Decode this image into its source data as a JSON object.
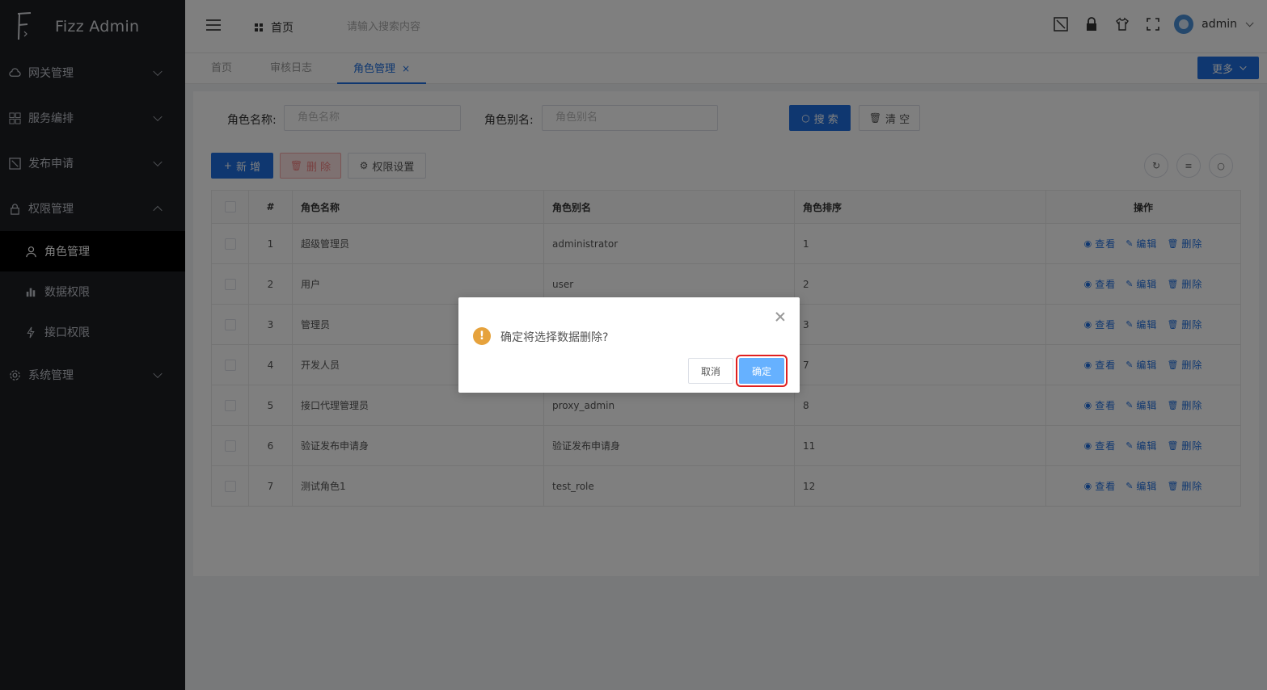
{
  "app": {
    "title": "Fizz Admin"
  },
  "sidebar": {
    "items": [
      {
        "label": "网关管理",
        "icon": "cloud-icon",
        "expanded": false
      },
      {
        "label": "服务编排",
        "icon": "grid-icon",
        "expanded": false
      },
      {
        "label": "发布申请",
        "icon": "publish-icon",
        "expanded": false
      },
      {
        "label": "权限管理",
        "icon": "lock-icon",
        "expanded": true,
        "children": [
          {
            "label": "角色管理",
            "icon": "user-icon",
            "active": true
          },
          {
            "label": "数据权限",
            "icon": "bar-chart-icon"
          },
          {
            "label": "接口权限",
            "icon": "lightning-icon"
          }
        ]
      },
      {
        "label": "系统管理",
        "icon": "gear-icon",
        "expanded": false
      }
    ]
  },
  "header": {
    "home_label": "首页",
    "search_placeholder": "请输入搜索内容",
    "username": "admin"
  },
  "tabs": {
    "items": [
      "首页",
      "审核日志",
      "角色管理"
    ],
    "close_label": "×",
    "more_label": "更多"
  },
  "filters": {
    "role_name_label": "角色名称:",
    "role_name_placeholder": "角色名称",
    "role_alias_label": "角色别名:",
    "role_alias_placeholder": "角色别名",
    "search_label": "搜 索",
    "clear_label": "清 空"
  },
  "toolbar": {
    "add_label": "新 增",
    "delete_label": "删 除",
    "perm_label": "权限设置"
  },
  "table": {
    "headers": [
      "#",
      "角色名称",
      "角色别名",
      "角色排序",
      "操作"
    ],
    "rows": [
      {
        "index": "1",
        "name": "超级管理员",
        "alias": "administrator",
        "sort": "1"
      },
      {
        "index": "2",
        "name": "用户",
        "alias": "user",
        "sort": "2"
      },
      {
        "index": "3",
        "name": "管理员",
        "alias": "",
        "sort": "3"
      },
      {
        "index": "4",
        "name": "开发人员",
        "alias": "",
        "sort": "7"
      },
      {
        "index": "5",
        "name": "接口代理管理员",
        "alias": "proxy_admin",
        "sort": "8"
      },
      {
        "index": "6",
        "name": "验证发布申请身",
        "alias": "验证发布申请身",
        "sort": "11"
      },
      {
        "index": "7",
        "name": "测试角色1",
        "alias": "test_role",
        "sort": "12"
      }
    ],
    "ops": {
      "view": "查看",
      "edit": "编辑",
      "delete": "删除"
    }
  },
  "dialog": {
    "message": "确定将选择数据删除?",
    "cancel_label": "取消",
    "ok_label": "确定"
  },
  "colors": {
    "primary": "#1e6fe0",
    "sidebar_bg": "#1d1e23",
    "warning": "#e6a23c",
    "highlight": "#e02020"
  }
}
